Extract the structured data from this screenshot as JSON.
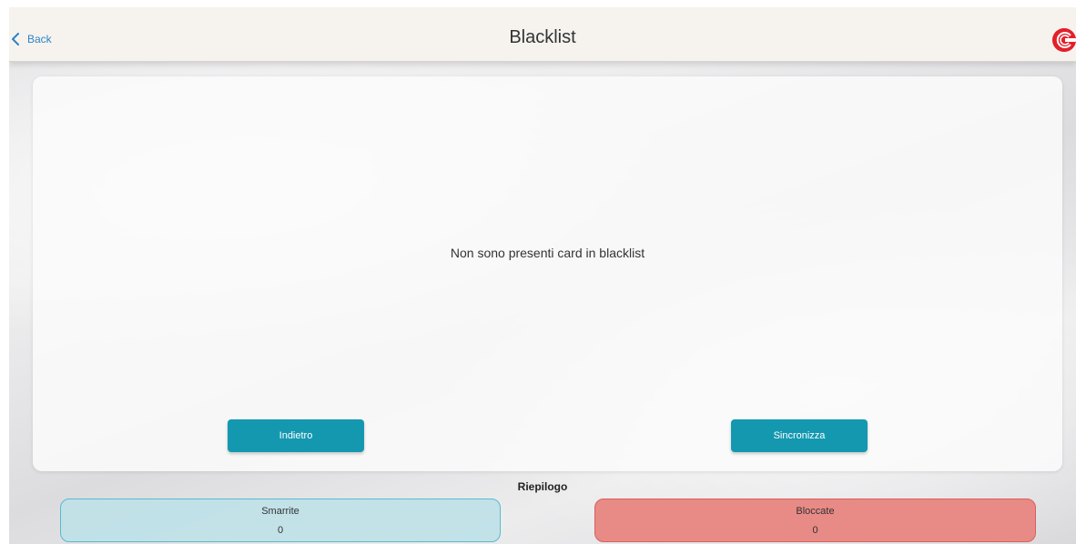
{
  "header": {
    "back_label": "Back",
    "title": "Blacklist",
    "logo_icon": "brand-logo-icon",
    "back_color": "#2f83c4"
  },
  "main": {
    "empty_message": "Non sono presenti card in blacklist",
    "buttons": {
      "back_label": "Indietro",
      "sync_label": "Sincronizza"
    },
    "button_color": "#1498b0"
  },
  "summary": {
    "title": "Riepilogo",
    "lost": {
      "label": "Smarrite",
      "value": "0",
      "color": "#bee1e8"
    },
    "blocked": {
      "label": "Bloccate",
      "value": "0",
      "color": "#e88a86"
    }
  }
}
